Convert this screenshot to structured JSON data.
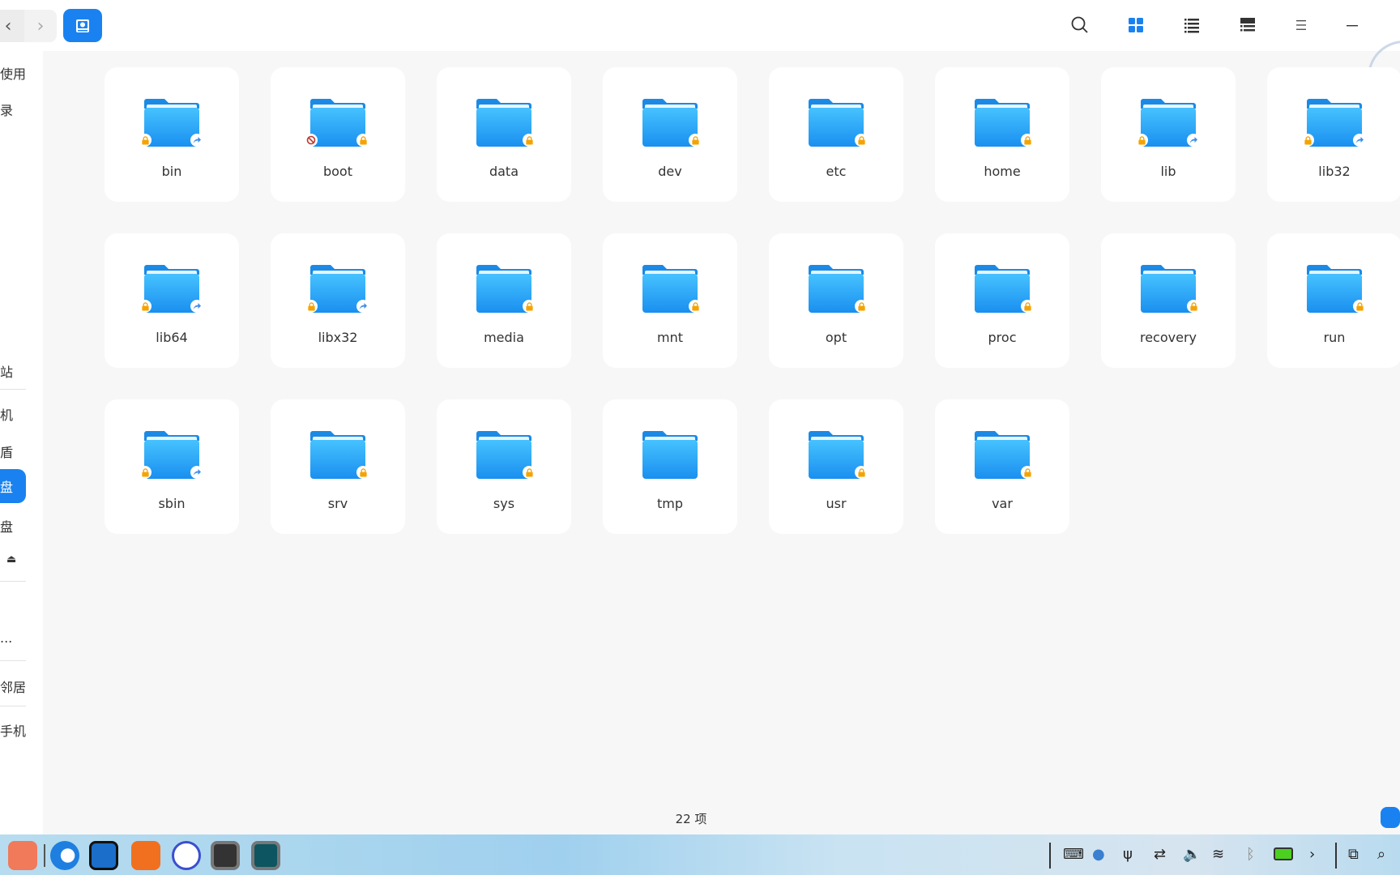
{
  "toolbar": {
    "back_icon": "chevron-left",
    "forward_icon": "chevron-right",
    "location_icon": "disk-icon",
    "search_icon": "search",
    "view_modes": [
      "icon-view",
      "list-view",
      "tree-view"
    ],
    "menu_icon": "menu",
    "minimize_icon": "minimize",
    "active_view": "icon-view",
    "accent": "#1a82f0"
  },
  "sidebar": {
    "items": [
      {
        "label": "使用"
      },
      {
        "label": "录"
      },
      {
        "label": "站"
      },
      {
        "label": "机"
      },
      {
        "label": "盾"
      },
      {
        "label": "盘",
        "selected": true
      },
      {
        "label": "盘"
      },
      {
        "label": "⏏"
      },
      {
        "label": "..."
      },
      {
        "label": "邻居"
      },
      {
        "label": "手机"
      }
    ]
  },
  "folders": [
    {
      "name": "bin",
      "left": "lock",
      "right": "share"
    },
    {
      "name": "boot",
      "left": "forbidden",
      "right": "lock"
    },
    {
      "name": "data",
      "right": "lock"
    },
    {
      "name": "dev",
      "right": "lock"
    },
    {
      "name": "etc",
      "right": "lock"
    },
    {
      "name": "home",
      "right": "lock"
    },
    {
      "name": "lib",
      "left": "lock",
      "right": "share"
    },
    {
      "name": "lib32",
      "left": "lock",
      "right": "share"
    },
    {
      "name": "lib64",
      "left": "lock",
      "right": "share"
    },
    {
      "name": "libx32",
      "left": "lock",
      "right": "share"
    },
    {
      "name": "media",
      "right": "lock"
    },
    {
      "name": "mnt",
      "right": "lock"
    },
    {
      "name": "opt",
      "right": "lock"
    },
    {
      "name": "proc",
      "right": "lock"
    },
    {
      "name": "recovery",
      "right": "lock"
    },
    {
      "name": "run",
      "right": "lock"
    },
    {
      "name": "sbin",
      "left": "lock",
      "right": "share"
    },
    {
      "name": "srv",
      "right": "lock"
    },
    {
      "name": "sys",
      "right": "lock"
    },
    {
      "name": "tmp"
    },
    {
      "name": "usr",
      "right": "lock"
    },
    {
      "name": "var",
      "right": "lock"
    }
  ],
  "status": {
    "count": "22 项"
  },
  "taskbar": {
    "apps": [
      "launcher",
      "browser",
      "file-manager",
      "app-store",
      "settings",
      "terminal",
      "editor"
    ],
    "tray": [
      "keyboard",
      "screen-record",
      "usb",
      "network-transfer",
      "volume",
      "wifi",
      "bluetooth",
      "battery",
      "expand",
      "screenshot",
      "search"
    ]
  }
}
